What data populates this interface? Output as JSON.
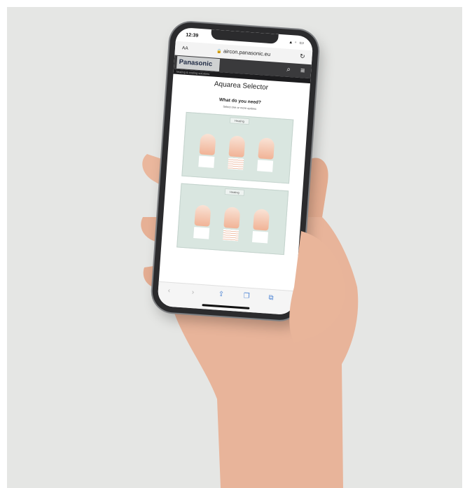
{
  "status_bar": {
    "time": "12:39",
    "indicators": "▴ ◦ ▭"
  },
  "browser": {
    "text_size_label": "AA",
    "lock_icon": "lock-icon",
    "url": "aircon.panasonic.eu",
    "reload_icon": "reload-icon",
    "toolbar": {
      "back": "‹",
      "forward": "›",
      "share": "⇪",
      "bookmarks": "❐",
      "tabs": "⧉"
    }
  },
  "site_header": {
    "logo": "Panasonic",
    "search_icon": "⌕",
    "menu_icon": "≡",
    "tagline": "heating & cooling solutions"
  },
  "page": {
    "title": "Aquarea Selector",
    "question": "What do you need?",
    "hint": "Select one or more options",
    "options": [
      {
        "label": "Heating"
      },
      {
        "label": "Heating"
      }
    ]
  },
  "colors": {
    "background": "#e5e6e4",
    "header": "#3a3a3c",
    "card": "#d9e6e0",
    "accent": "#f1b396"
  }
}
